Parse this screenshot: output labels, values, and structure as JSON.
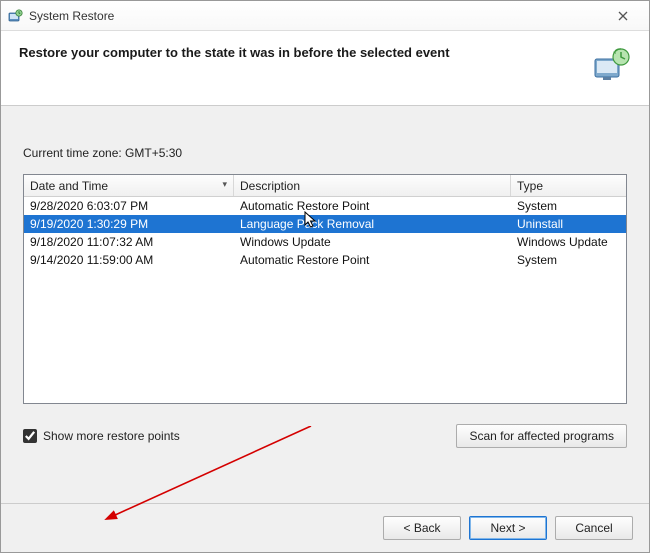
{
  "window": {
    "title": "System Restore"
  },
  "header": {
    "headline": "Restore your computer to the state it was in before the selected event"
  },
  "timezone_label": "Current time zone: GMT+5:30",
  "table": {
    "columns": {
      "datetime": "Date and Time",
      "description": "Description",
      "type": "Type"
    },
    "rows": [
      {
        "datetime": "9/28/2020 6:03:07 PM",
        "description": "Automatic Restore Point",
        "type": "System",
        "selected": false
      },
      {
        "datetime": "9/19/2020 1:30:29 PM",
        "description": "Language Pack Removal",
        "type": "Uninstall",
        "selected": true
      },
      {
        "datetime": "9/18/2020 11:07:32 AM",
        "description": "Windows Update",
        "type": "Windows Update",
        "selected": false
      },
      {
        "datetime": "9/14/2020 11:59:00 AM",
        "description": "Automatic Restore Point",
        "type": "System",
        "selected": false
      }
    ]
  },
  "checkbox": {
    "label": "Show more restore points",
    "checked": true
  },
  "buttons": {
    "scan": "Scan for affected programs",
    "back": "< Back",
    "next": "Next >",
    "cancel": "Cancel"
  },
  "annotations": {
    "arrow_color": "#d40000"
  }
}
